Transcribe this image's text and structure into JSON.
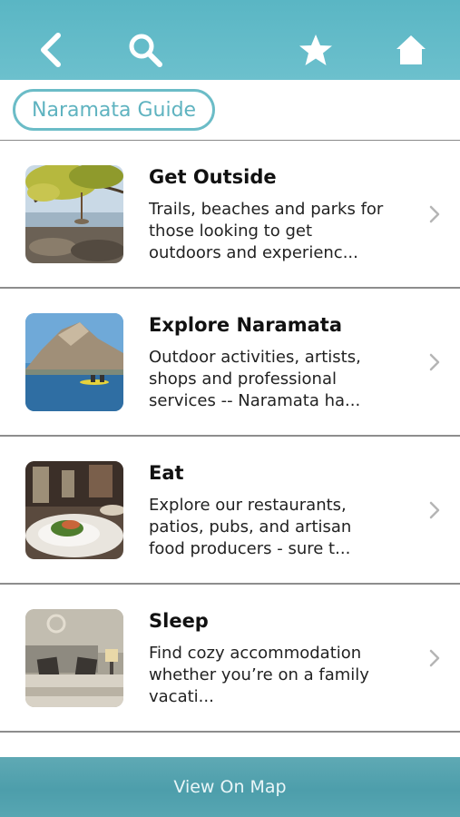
{
  "header": {
    "icons": [
      "back-icon",
      "search-icon",
      "star-icon",
      "home-icon"
    ]
  },
  "guide_pill": {
    "label": "Naramata Guide"
  },
  "items": [
    {
      "title": "Get Outside",
      "description": "Trails, beaches and parks for those looking to get outdoors and experienc...",
      "thumbnail": "lake-shore-tree-photo"
    },
    {
      "title": "Explore Naramata",
      "description": "Outdoor activities, artists, shops and professional services -- Naramata ha...",
      "thumbnail": "mountain-lake-kayak-photo"
    },
    {
      "title": "Eat",
      "description": "Explore our restaurants, patios,  pubs, and artisan food producers  - sure t...",
      "thumbnail": "restaurant-plate-photo"
    },
    {
      "title": "Sleep",
      "description": "Find cozy accommodation whether you’re on a family vacati...",
      "thumbnail": "hotel-bedroom-photo"
    }
  ],
  "footer": {
    "label": "View On Map"
  },
  "colors": {
    "header_teal": "#5ab6c4",
    "pill_border": "#6bbcc7",
    "footer_teal": "#4d9eab"
  }
}
